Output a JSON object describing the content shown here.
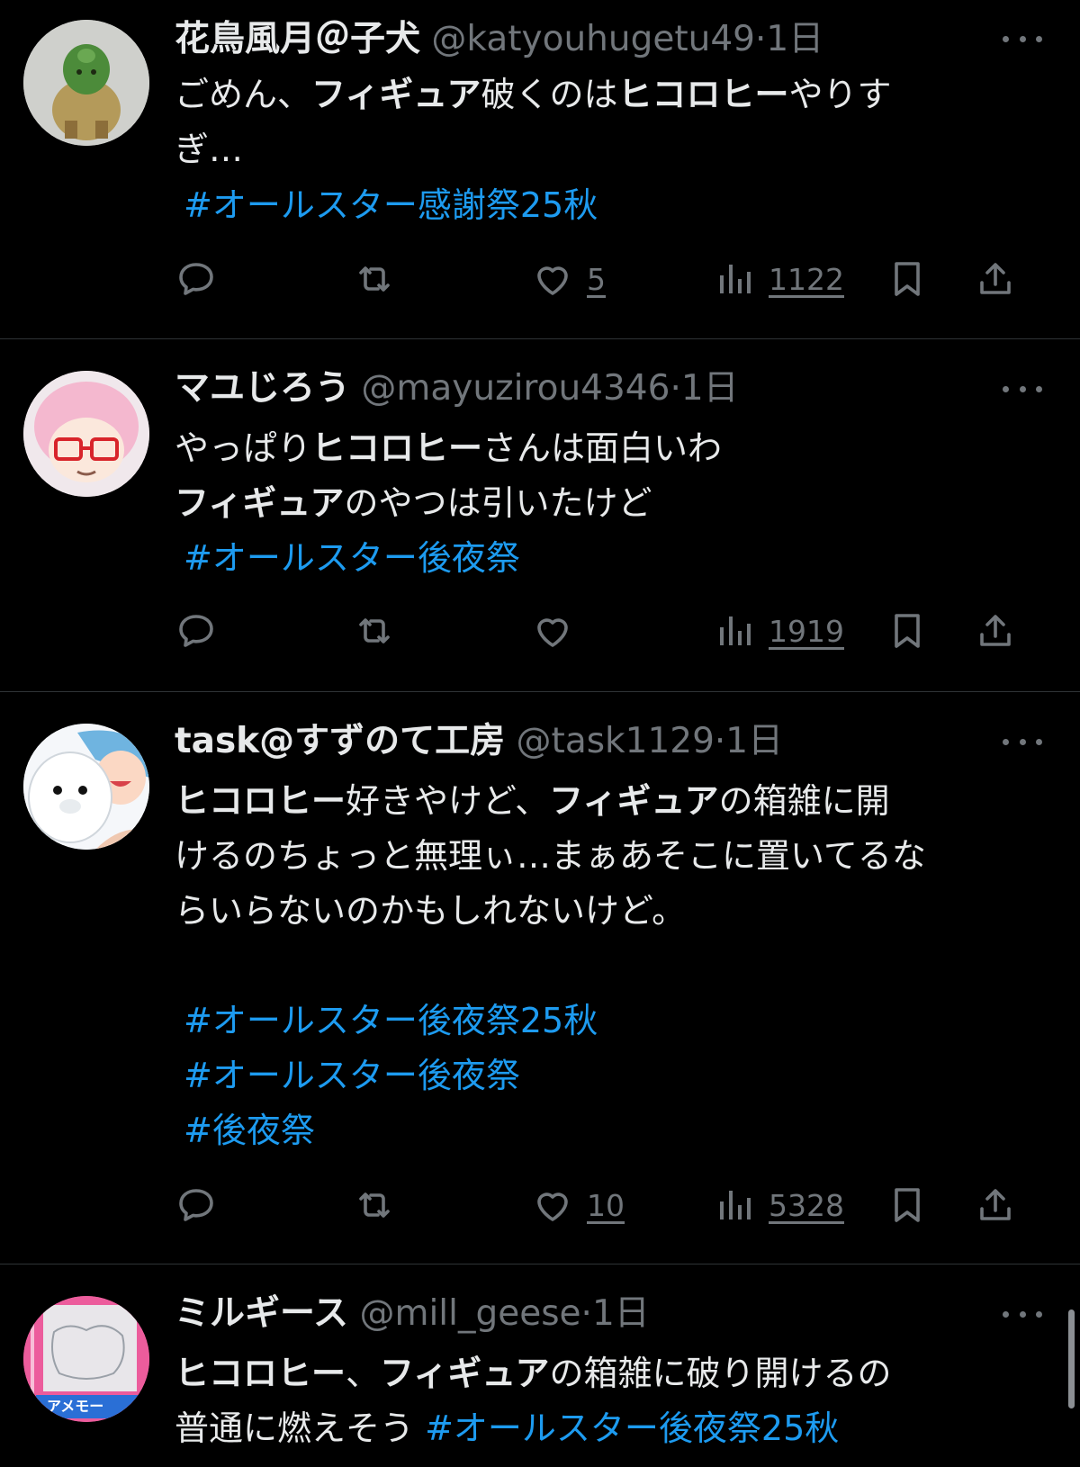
{
  "tweets": [
    {
      "name": "花鳥風月＠子犬",
      "handle": "@katyouhugetu49",
      "time": "1日",
      "body_lines": [
        [
          {
            "t": "ごめん、",
            "b": false
          },
          {
            "t": "フィギュア",
            "b": true
          },
          {
            "t": "破くのは",
            "b": false
          },
          {
            "t": "ヒコロヒー",
            "b": true
          },
          {
            "t": "やりす",
            "b": false
          }
        ],
        [
          {
            "t": "ぎ…",
            "b": false
          }
        ]
      ],
      "hashtags": [
        "#オールスター感謝祭25秋"
      ],
      "likes": "5",
      "views": "1122"
    },
    {
      "name": "マユじろう",
      "handle": "@mayuzirou4346",
      "time": "1日",
      "body_lines": [
        [
          {
            "t": "やっぱり",
            "b": false
          },
          {
            "t": "ヒコロヒー",
            "b": true
          },
          {
            "t": "さんは面白いわ",
            "b": false
          }
        ],
        [
          {
            "t": "フィギュア",
            "b": true
          },
          {
            "t": "のやつは引いたけど",
            "b": false
          }
        ]
      ],
      "hashtags": [
        "#オールスター後夜祭"
      ],
      "likes": "",
      "views": "1919"
    },
    {
      "name": "task@すずのて工房",
      "handle": "@task1129",
      "time": "1日",
      "body_lines": [
        [
          {
            "t": "ヒコロヒー",
            "b": true
          },
          {
            "t": "好きやけど、",
            "b": false
          },
          {
            "t": "フィギュア",
            "b": true
          },
          {
            "t": "の箱雑に開",
            "b": false
          }
        ],
        [
          {
            "t": "けるのちょっと無理ぃ…まぁあそこに置いてるな",
            "b": false
          }
        ],
        [
          {
            "t": "らいらないのかもしれないけど。",
            "b": false
          }
        ],
        [
          {
            "t": " ",
            "b": false
          }
        ]
      ],
      "hashtags": [
        "#オールスター後夜祭25秋",
        "#オールスター後夜祭",
        "#後夜祭"
      ],
      "likes": "10",
      "views": "5328"
    },
    {
      "name": "ミルギース",
      "handle": "@mill_geese",
      "time": "1日",
      "body_lines": [
        [
          {
            "t": "ヒコロヒー",
            "b": true
          },
          {
            "t": "、",
            "b": false
          },
          {
            "t": "フィギュア",
            "b": true
          },
          {
            "t": "の箱雑に破り開けるの",
            "b": false
          }
        ],
        [
          {
            "t": "普通に燃えそう ",
            "b": false
          }
        ]
      ],
      "inline_hashtag": "#オールスター後夜祭25秋",
      "avatar_text": "アメモー"
    }
  ],
  "separator_dot": "·",
  "icons": [
    "reply-icon",
    "retweet-icon",
    "like-icon",
    "views-icon",
    "bookmark-icon",
    "share-icon",
    "more-icon"
  ],
  "colors": {
    "background": "#000000",
    "text": "#e7e9ea",
    "secondary": "#71767b",
    "link": "#1d9bf0",
    "divider": "#2f3336"
  }
}
